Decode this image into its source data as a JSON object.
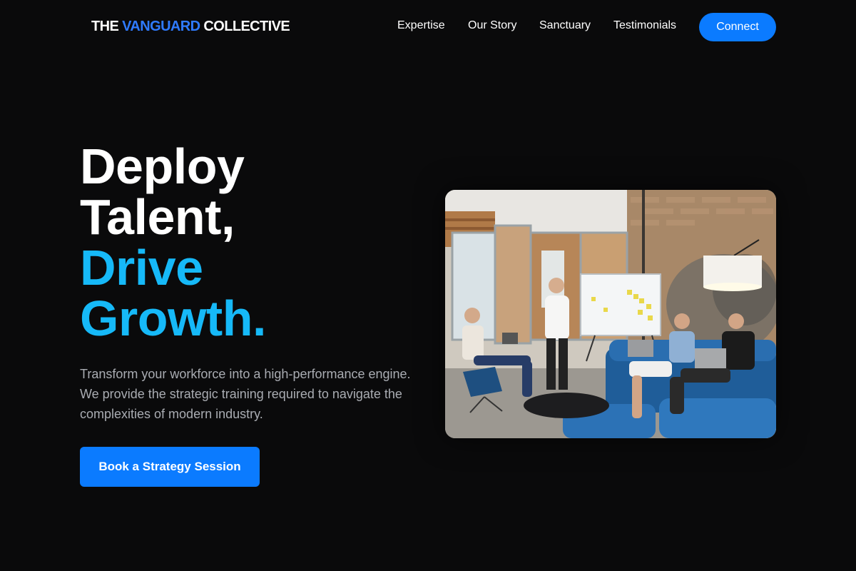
{
  "header": {
    "logo": {
      "part1": "THE ",
      "accent": "VANGUARD",
      "part2": " COLLECTIVE"
    },
    "nav": [
      "Expertise",
      "Our Story",
      "Sanctuary",
      "Testimonials"
    ],
    "connect_label": "Connect"
  },
  "hero": {
    "headline": [
      "Deploy",
      "Talent,",
      "Drive",
      "Growth."
    ],
    "lead": [
      "Transform your workforce into a high-performance engine.",
      "We provide the strategic training required to navigate the",
      "complexities of modern industry."
    ],
    "cta_label": "Book a Strategy Session"
  },
  "colors": {
    "background": "#0a0a0b",
    "accent_blue": "#0b7bff",
    "headline_cyan": "#16b9f8",
    "logo_blue": "#2f7bff",
    "lead_gray": "#a9acb2"
  }
}
